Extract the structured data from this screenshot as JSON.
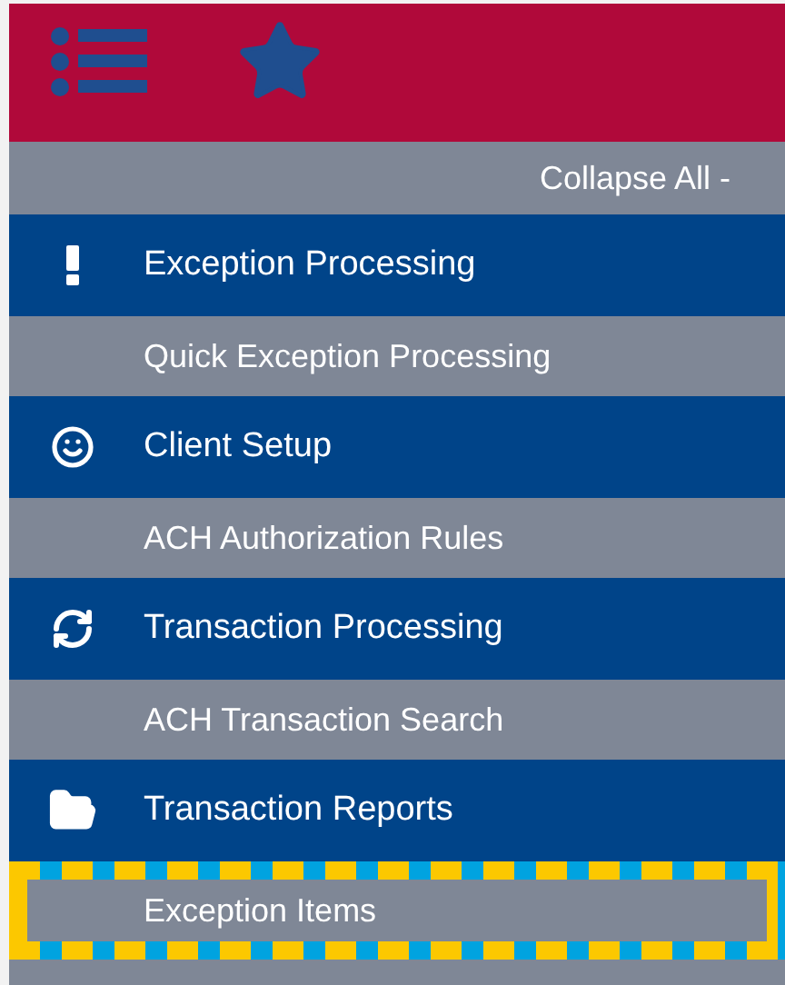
{
  "header": {
    "kind": "toolbar"
  },
  "collapse_all": "Collapse All -",
  "sections": [
    {
      "label": "Exception Processing",
      "items": [
        {
          "label": "Quick Exception Processing",
          "selected": false
        }
      ]
    },
    {
      "label": "Client Setup",
      "items": [
        {
          "label": "ACH Authorization Rules",
          "selected": false
        }
      ]
    },
    {
      "label": "Transaction Processing",
      "items": [
        {
          "label": "ACH Transaction Search",
          "selected": false
        }
      ]
    },
    {
      "label": "Transaction Reports",
      "items": [
        {
          "label": "Exception Items",
          "selected": true
        }
      ]
    }
  ]
}
